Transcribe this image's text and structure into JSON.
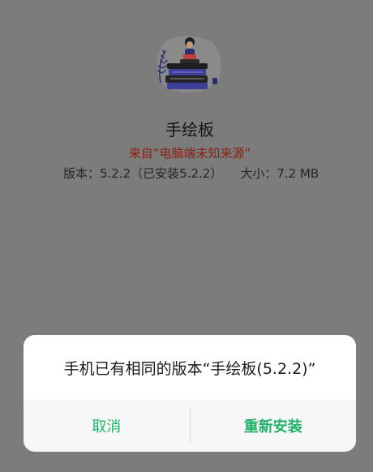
{
  "app": {
    "name": "手绘板",
    "source": "来自“电脑端未知来源”",
    "version_text": "版本：5.2.2（已安装5.2.2）",
    "size_text": "大小：7.2 MB",
    "icon": "books-reading-girl-illustration"
  },
  "dialog": {
    "message": "手机已有相同的版本“手绘板(5.2.2)”",
    "cancel_label": "取消",
    "reinstall_label": "重新安装"
  },
  "colors": {
    "overlay_background": "#7c7c7c",
    "accent_green": "#23b26a",
    "source_red": "#8a2010"
  }
}
